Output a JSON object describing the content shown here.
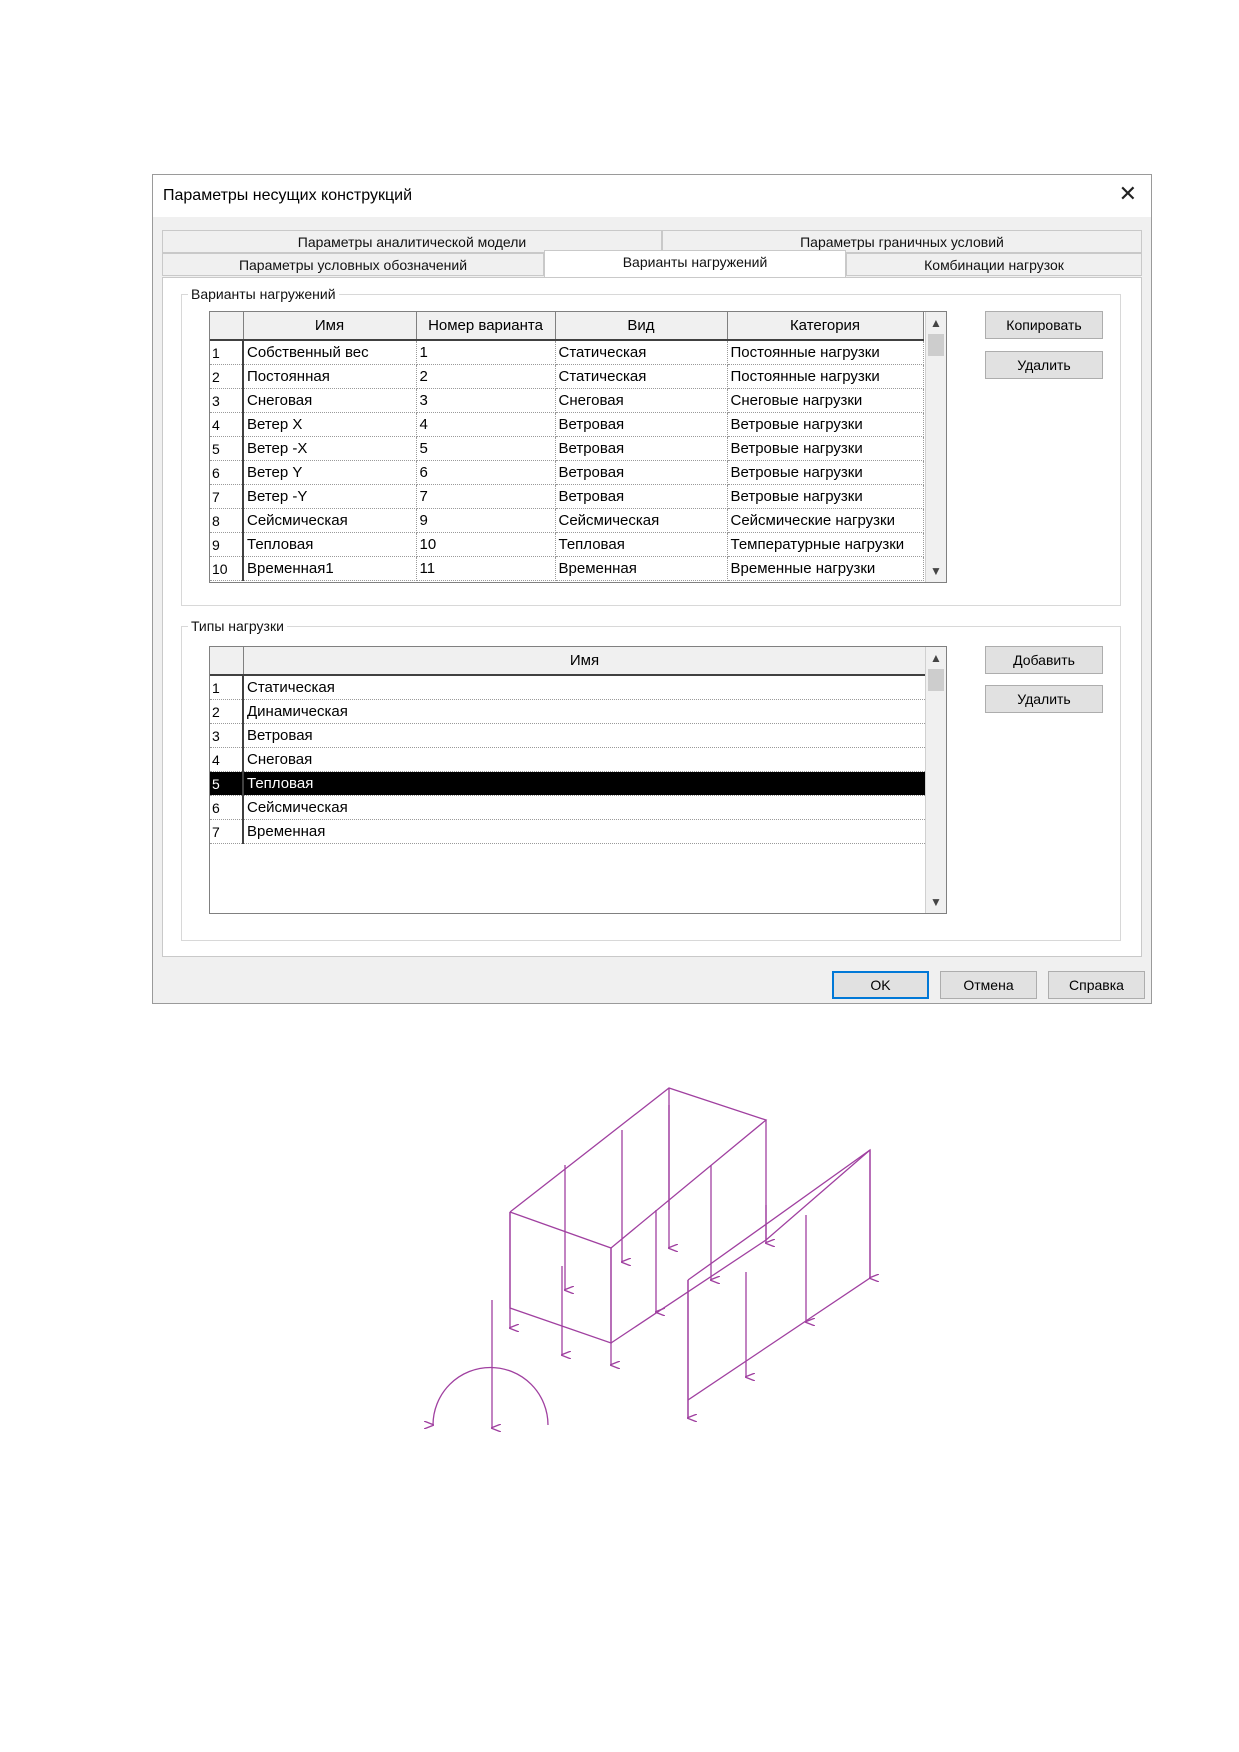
{
  "dialog": {
    "title": "Параметры несущих конструкций",
    "close_glyph": "✕",
    "tabs": [
      {
        "label": "Параметры аналитической модели"
      },
      {
        "label": "Параметры граничных условий"
      },
      {
        "label": "Параметры условных обозначений"
      },
      {
        "label": "Варианты нагружений"
      },
      {
        "label": "Комбинации нагрузок"
      }
    ],
    "active_tab": "Варианты нагружений"
  },
  "load_cases": {
    "group_label": "Варианты нагружений",
    "columns": [
      "Имя",
      "Номер варианта",
      "Вид",
      "Категория"
    ],
    "rows": [
      {
        "n": "1",
        "name": "Собственный вес",
        "num": "1",
        "kind": "Статическая",
        "category": "Постоянные нагрузки"
      },
      {
        "n": "2",
        "name": "Постоянная",
        "num": "2",
        "kind": "Статическая",
        "category": "Постоянные нагрузки"
      },
      {
        "n": "3",
        "name": "Снеговая",
        "num": "3",
        "kind": "Снеговая",
        "category": "Снеговые нагрузки"
      },
      {
        "n": "4",
        "name": "Ветер X",
        "num": "4",
        "kind": "Ветровая",
        "category": "Ветровые нагрузки"
      },
      {
        "n": "5",
        "name": "Ветер -X",
        "num": "5",
        "kind": "Ветровая",
        "category": "Ветровые нагрузки"
      },
      {
        "n": "6",
        "name": "Ветер Y",
        "num": "6",
        "kind": "Ветровая",
        "category": "Ветровые нагрузки"
      },
      {
        "n": "7",
        "name": "Ветер -Y",
        "num": "7",
        "kind": "Ветровая",
        "category": "Ветровые нагрузки"
      },
      {
        "n": "8",
        "name": "Сейсмическая",
        "num": "9",
        "kind": "Сейсмическая",
        "category": "Сейсмические нагрузки"
      },
      {
        "n": "9",
        "name": "Тепловая",
        "num": "10",
        "kind": "Тепловая",
        "category": "Температурные нагрузки"
      },
      {
        "n": "10",
        "name": "Временная1",
        "num": "11",
        "kind": "Временная",
        "category": "Временные нагрузки"
      }
    ],
    "buttons": {
      "copy": "Копировать",
      "delete": "Удалить"
    }
  },
  "load_types": {
    "group_label": "Типы нагрузки",
    "columns": [
      "Имя"
    ],
    "rows": [
      {
        "n": "1",
        "name": "Статическая"
      },
      {
        "n": "2",
        "name": "Динамическая"
      },
      {
        "n": "3",
        "name": "Ветровая"
      },
      {
        "n": "4",
        "name": "Снеговая"
      },
      {
        "n": "5",
        "name": "Тепловая"
      },
      {
        "n": "6",
        "name": "Сейсмическая"
      },
      {
        "n": "7",
        "name": "Временная"
      }
    ],
    "selected_row": "5",
    "buttons": {
      "add": "Добавить",
      "delete": "Удалить"
    }
  },
  "footer": {
    "ok": "OK",
    "cancel": "Отмена",
    "help": "Справка"
  },
  "scroll_glyphs": {
    "up": "▲",
    "down": "▼"
  },
  "colors": {
    "diagram_stroke": "#a040a0",
    "dialog_bg": "#f0f0f0",
    "default_button_border": "#0078d7"
  }
}
